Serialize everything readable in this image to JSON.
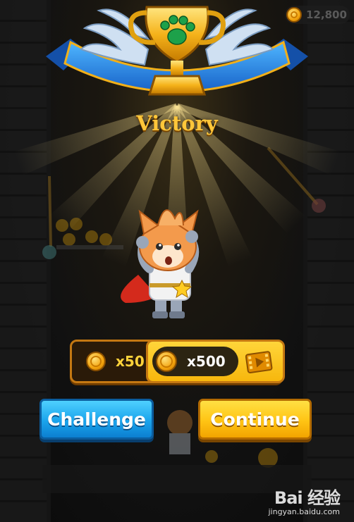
{
  "hud": {
    "coin_total": "12,800"
  },
  "result": {
    "title": "Victory"
  },
  "rewards": {
    "base_amount": "x50",
    "bonus_amount": "x500",
    "bonus_icon": "video-ad-icon"
  },
  "buttons": {
    "challenge_label": "Challenge",
    "continue_label": "Continue"
  },
  "watermark": {
    "brand": "Bai 经验",
    "url": "jingyan.baidu.com"
  },
  "colors": {
    "title": "#ffc73a",
    "challenge": "#1aa4ec",
    "continue": "#ffc414"
  }
}
